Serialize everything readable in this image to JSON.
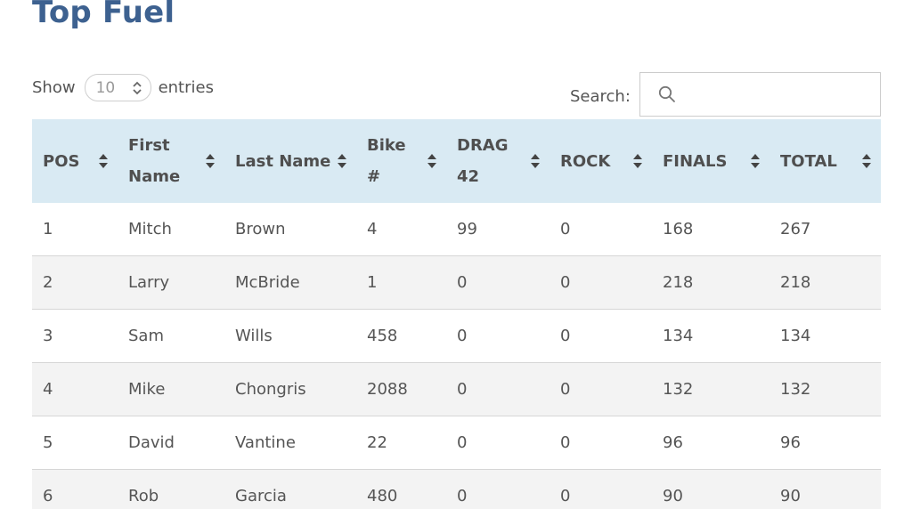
{
  "page": {
    "title": "Top Fuel"
  },
  "length": {
    "prefix": "Show",
    "value": "10",
    "suffix": "entries"
  },
  "search": {
    "label": "Search:",
    "value": "",
    "icon": "search-icon"
  },
  "colors": {
    "title": "#3d6190",
    "header_bg": "#d9eaf3",
    "stripe_bg": "#f3f3f3"
  },
  "table": {
    "columns": [
      "POS",
      "First Name",
      "Last Name",
      "Bike #",
      "DRAG 42",
      "ROCK",
      "FINALS",
      "TOTAL"
    ],
    "rows": [
      [
        "1",
        "Mitch",
        "Brown",
        "4",
        "99",
        "0",
        "168",
        "267"
      ],
      [
        "2",
        "Larry",
        "McBride",
        "1",
        "0",
        "0",
        "218",
        "218"
      ],
      [
        "3",
        "Sam",
        "Wills",
        "458",
        "0",
        "0",
        "134",
        "134"
      ],
      [
        "4",
        "Mike",
        "Chongris",
        "2088",
        "0",
        "0",
        "132",
        "132"
      ],
      [
        "5",
        "David",
        "Vantine",
        "22",
        "0",
        "0",
        "96",
        "96"
      ],
      [
        "6",
        "Rob",
        "Garcia",
        "480",
        "0",
        "0",
        "90",
        "90"
      ]
    ]
  }
}
